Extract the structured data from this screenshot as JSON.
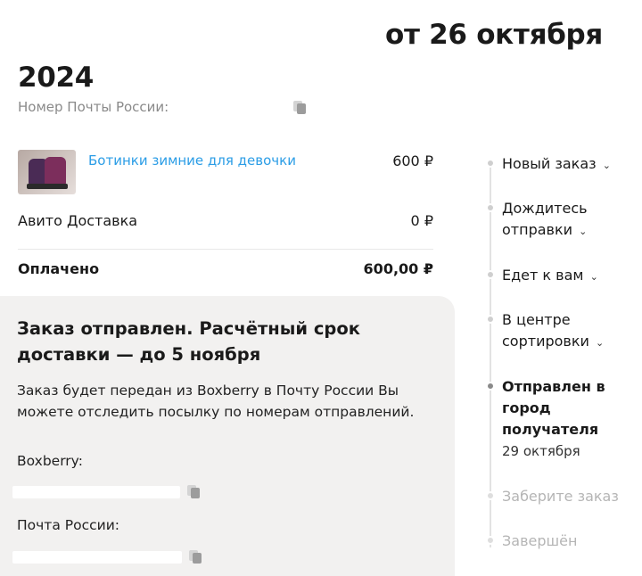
{
  "header": {
    "title_line1": "от 26 октября",
    "title_line2": "2024",
    "post_number_label": "Номер Почты России:"
  },
  "order": {
    "item_name": "Ботинки зимние для девочки",
    "item_price": "600 ₽",
    "delivery_label": "Авито Доставка",
    "delivery_price": "0 ₽",
    "paid_label": "Оплачено",
    "paid_total": "600,00 ₽"
  },
  "status_card": {
    "heading": "Заказ отправлен. Расчётный срок доставки — до 5 ноября",
    "description": "Заказ будет передан из Boxberry в Почту России Вы можете отследить посылку по номерам отправлений.",
    "boxberry_label": "Boxberry:",
    "russian_post_label": "Почта России:"
  },
  "timeline": {
    "steps": [
      {
        "label": "Новый заказ",
        "chevron": "⌄"
      },
      {
        "label": "Дождитесь отправки",
        "chevron": "⌄"
      },
      {
        "label": "Едет к вам",
        "chevron": "⌄"
      },
      {
        "label": "В центре сортировки",
        "chevron": "⌄"
      },
      {
        "label": "Отправлен в город получателя",
        "date": "29 октября"
      },
      {
        "label": "Заберите заказ"
      },
      {
        "label": "Завершён"
      }
    ]
  },
  "colors": {
    "link": "#2b9de6",
    "card_bg": "#f2f1f0",
    "muted": "#8a8a8a"
  }
}
